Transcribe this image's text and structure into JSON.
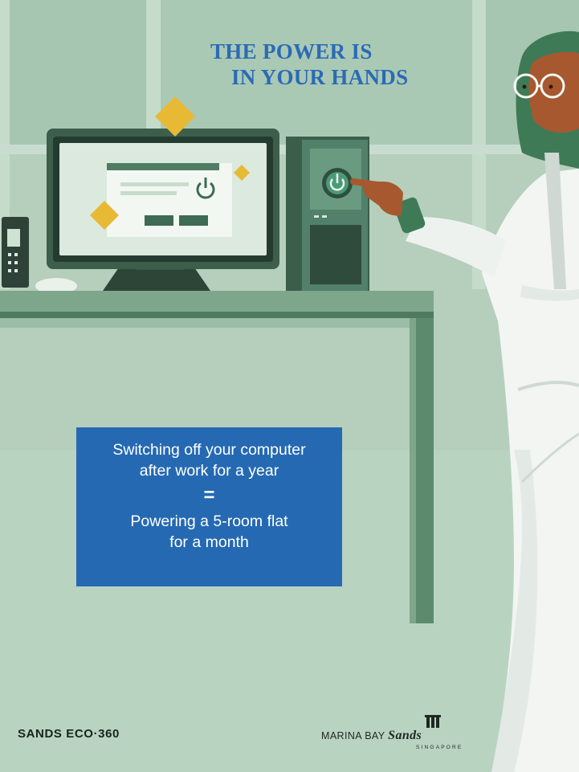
{
  "poster": {
    "headline": {
      "line1": "THE POWER IS",
      "line2": "IN YOUR HANDS"
    },
    "stat": {
      "line1": "Switching off your computer",
      "line2": "after work for a year",
      "equals": "=",
      "line3": "Powering a 5-room flat",
      "line4": "for a month"
    },
    "footer": {
      "eco_brand": "SANDS ECO·360",
      "mbs_prefix": "MARINA BAY",
      "mbs_sands": "Sands",
      "mbs_location": "SINGAPORE"
    },
    "colors": {
      "accent_blue": "#2569b3",
      "headline_blue": "#2a6bb6",
      "background_green": "#b5cfbc",
      "desk_green": "#6f9a7c",
      "diamond_gold": "#e8b935"
    }
  }
}
